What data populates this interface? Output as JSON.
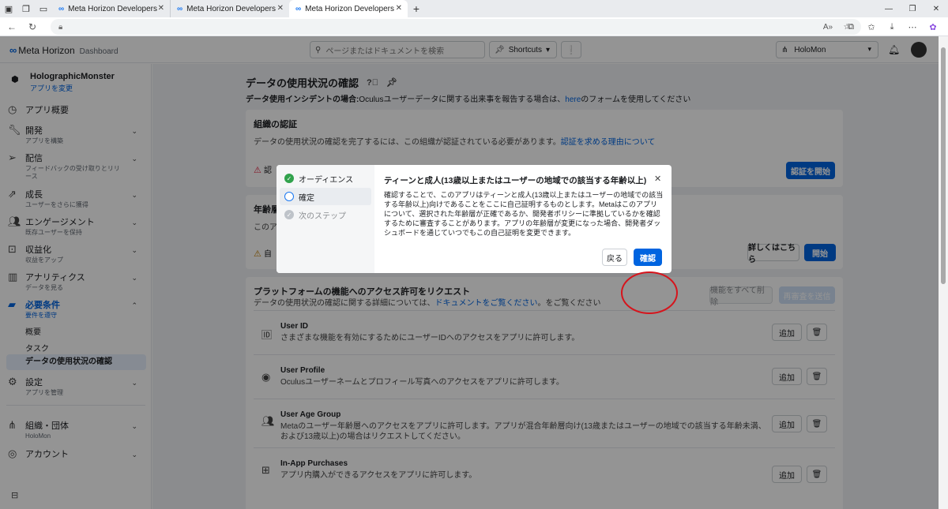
{
  "browser": {
    "tabs": [
      {
        "title": "Meta Horizon Developers"
      },
      {
        "title": "Meta Horizon Developers"
      },
      {
        "title": "Meta Horizon Developers"
      }
    ],
    "new_tab": "+"
  },
  "topnav": {
    "logo": "∞",
    "brand_name": "Meta Horizon",
    "dashboard": "Dashboard",
    "search_placeholder": "ページまたはドキュメントを検索",
    "shortcuts": "Shortcuts",
    "org_name": "HoloMon"
  },
  "sidebar": {
    "app_name": "HolographicMonster",
    "app_change": "アプリを変更",
    "items": [
      {
        "label": "アプリ概要",
        "sub": ""
      },
      {
        "label": "開発",
        "sub": "アプリを構築"
      },
      {
        "label": "配信",
        "sub": "フィードバックの受け取りとリリース"
      },
      {
        "label": "成長",
        "sub": "ユーザーをさらに獲得"
      },
      {
        "label": "エンゲージメント",
        "sub": "既存ユーザーを保持"
      },
      {
        "label": "収益化",
        "sub": "収益をアップ"
      },
      {
        "label": "アナリティクス",
        "sub": "データを見る"
      },
      {
        "label": "必要条件",
        "sub": "要件を遵守"
      },
      {
        "label": "設定",
        "sub": "アプリを管理"
      },
      {
        "label": "組織・団体",
        "sub": "HoloMon"
      },
      {
        "label": "アカウント",
        "sub": ""
      }
    ],
    "children": [
      "概要",
      "タスク",
      "データの使用状況の確認"
    ]
  },
  "main": {
    "title": "データの使用状況の確認",
    "incident_label": "データ使用インシデントの場合:",
    "incident_text": "Oculusユーザーデータに関する出来事を報告する場合は、",
    "incident_link": "here",
    "incident_tail": "のフォームを使用してください",
    "org_card": {
      "title": "組織の認証",
      "desc": "データの使用状況の確認を完了するには、この組織が認証されている必要があります。",
      "link": "認証を求める理由について",
      "warn_text": "認",
      "button": "認証を開始"
    },
    "age_card": {
      "title": "年齢層",
      "desc": "このア",
      "warn_text": "自",
      "details_button": "詳しくはこちら",
      "start_button": "開始"
    },
    "perm_card": {
      "title": "プラットフォームの機能へのアクセス許可をリクエスト",
      "desc": "データの使用状況の確認に関する詳細については、",
      "link": "ドキュメントをご覧ください",
      "desc_tail": "。をご覧ください",
      "remove_all": "機能をすべて削除",
      "submit": "再審査を送信",
      "add_label": "追加",
      "rows": [
        {
          "title": "User ID",
          "desc": "さまざまな機能を有効にするためにユーザーIDへのアクセスをアプリに許可します。"
        },
        {
          "title": "User Profile",
          "desc": "Oculusユーザーネームとプロフィール写真へのアクセスをアプリに許可します。"
        },
        {
          "title": "User Age Group",
          "desc": "Metaのユーザー年齢層へのアクセスをアプリに許可します。アプリが混合年齢層向け(13歳またはユーザーの地域での該当する年齢未満、および13歳以上)の場合はリクエストしてください。"
        },
        {
          "title": "In-App Purchases",
          "desc": "アプリ内購入ができるアクセスをアプリに許可します。"
        }
      ]
    }
  },
  "modal": {
    "steps": [
      {
        "label": "オーディエンス",
        "state": "done"
      },
      {
        "label": "確定",
        "state": "current"
      },
      {
        "label": "次のステップ",
        "state": "next"
      }
    ],
    "title": "ティーンと成人(13歳以上またはユーザーの地域での該当する年齢以上)",
    "body": "確認することで、このアプリはティーンと成人(13歳以上またはユーザーの地域での該当する年齢以上)向けであることをここに自己証明するものとします。Metaはこのアプリについて、選択された年齢層が正確であるか、開発者ポリシーに準拠しているかを確認するために審査することがあります。アプリの年齢層が変更になった場合、開発者ダッシュボードを通じていつでもこの自己証明を変更できます。",
    "back": "戻る",
    "confirm": "確認"
  },
  "colors": {
    "accent": "#0064e0",
    "highlight": "#d6141c",
    "success": "#31a24c"
  }
}
